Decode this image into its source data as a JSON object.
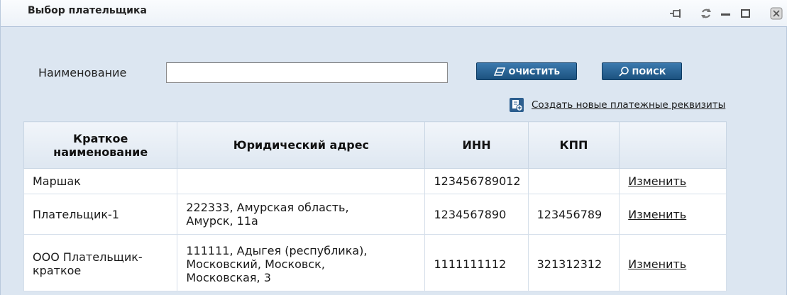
{
  "window": {
    "title": "Выбор плательщика",
    "controls": [
      "pin-icon",
      "refresh-icon",
      "minimize-icon",
      "maximize-icon",
      "close-icon"
    ]
  },
  "form": {
    "name_label": "Наименование",
    "name_value": "",
    "clear_label": "ОЧИСТИТЬ",
    "search_label": "ПОИСК",
    "create_link": "Создать новые платежные реквизиты"
  },
  "table": {
    "columns": [
      "Краткое наименование",
      "Юридический адрес",
      "ИНН",
      "КПП",
      ""
    ],
    "rows": [
      {
        "short_name": "Маршак",
        "address": "",
        "inn": "123456789012",
        "kpp": "",
        "action": "Изменить"
      },
      {
        "short_name": "Плательщик-1",
        "address": "222333, Амурская область, Амурск, 11а",
        "inn": "1234567890",
        "kpp": "123456789",
        "action": "Изменить"
      },
      {
        "short_name": "ООО Плательщик-краткое",
        "address": "111111, Адыгея (республика), Московский, Московск, Московская, 3",
        "inn": "1111111112",
        "kpp": "321312312",
        "action": "Изменить"
      }
    ]
  },
  "colors": {
    "button": "#2a6496",
    "link": "#2a6fb6",
    "window_bg": "#dce6f1"
  }
}
